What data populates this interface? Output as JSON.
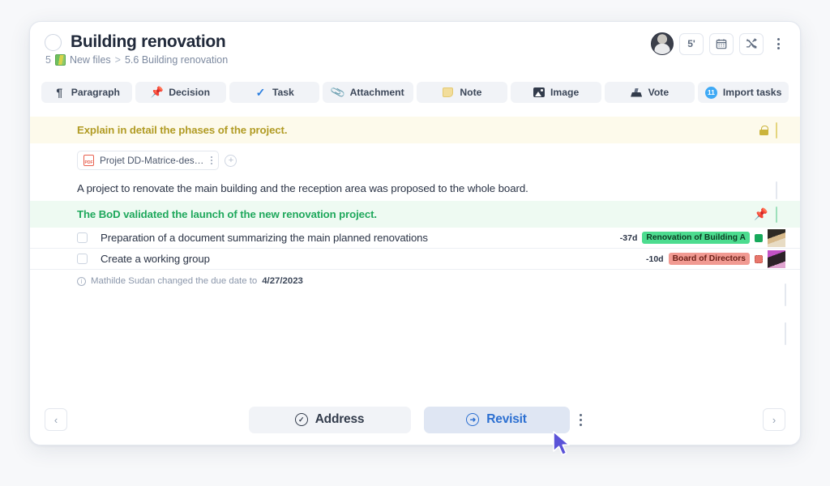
{
  "header": {
    "title": "Building renovation",
    "breadcrumb_number": "5",
    "breadcrumb_root": "New files",
    "breadcrumb_sep": ">",
    "breadcrumb_current": "5.6 Building renovation",
    "timer_label": "5'",
    "calendar_icon": "calendar-icon",
    "shuffle_icon": "shuffle-off-icon",
    "menu_icon": "kebab-menu-icon",
    "avatar_icon": "user-avatar"
  },
  "toolbar": {
    "items": [
      {
        "label": "Paragraph",
        "icon": "pilcrow-icon"
      },
      {
        "label": "Decision",
        "icon": "pushpin-icon"
      },
      {
        "label": "Task",
        "icon": "check-icon"
      },
      {
        "label": "Attachment",
        "icon": "paperclip-icon"
      },
      {
        "label": "Note",
        "icon": "sticky-note-icon"
      },
      {
        "label": "Image",
        "icon": "image-icon"
      },
      {
        "label": "Vote",
        "icon": "ballot-box-icon"
      },
      {
        "label": "Import tasks",
        "icon": "import-badge-icon",
        "badge": "11"
      }
    ]
  },
  "content": {
    "note": {
      "text": "Explain in detail the phases of the project.",
      "lock_icon": "lock-icon"
    },
    "attachment": {
      "filename": "Projet DD-Matrice-des…",
      "file_icon": "pdf-file-icon",
      "menu_icon": "kebab-menu-icon",
      "add_icon": "plus-circle-icon"
    },
    "paragraph": {
      "text": "A project to renovate the main building and the reception area was proposed to the whole board."
    },
    "decision": {
      "text": "The BoD validated the launch of the new renovation project.",
      "pin_icon": "pushpin-icon"
    },
    "tasks": [
      {
        "label": "Preparation of a document summarizing the main planned renovations",
        "due": "-37d",
        "tag": "Renovation of Building A",
        "tag_color": "green",
        "checkbox_icon": "checkbox-unchecked",
        "avatar_icon": "assignee-avatar"
      },
      {
        "label": "Create a working group",
        "due": "-10d",
        "tag": "Board of Directors",
        "tag_color": "red",
        "checkbox_icon": "checkbox-unchecked",
        "avatar_icon": "assignee-avatar"
      }
    ],
    "history": {
      "icon": "info-circle-icon",
      "text": "Mathilde Sudan changed the due date to",
      "date": "4/27/2023"
    }
  },
  "footer": {
    "prev_icon": "chevron-left-icon",
    "next_icon": "chevron-right-icon",
    "address_label": "Address",
    "address_icon": "check-circle-icon",
    "revisit_label": "Revisit",
    "revisit_icon": "arrow-circle-icon",
    "menu_icon": "kebab-menu-icon"
  },
  "colors": {
    "note_accent": "#b19b24",
    "decision_accent": "#1fa85c",
    "revisit_accent": "#2b6fd1",
    "tag_green": "#4cdc8f",
    "tag_red": "#f19a92"
  }
}
